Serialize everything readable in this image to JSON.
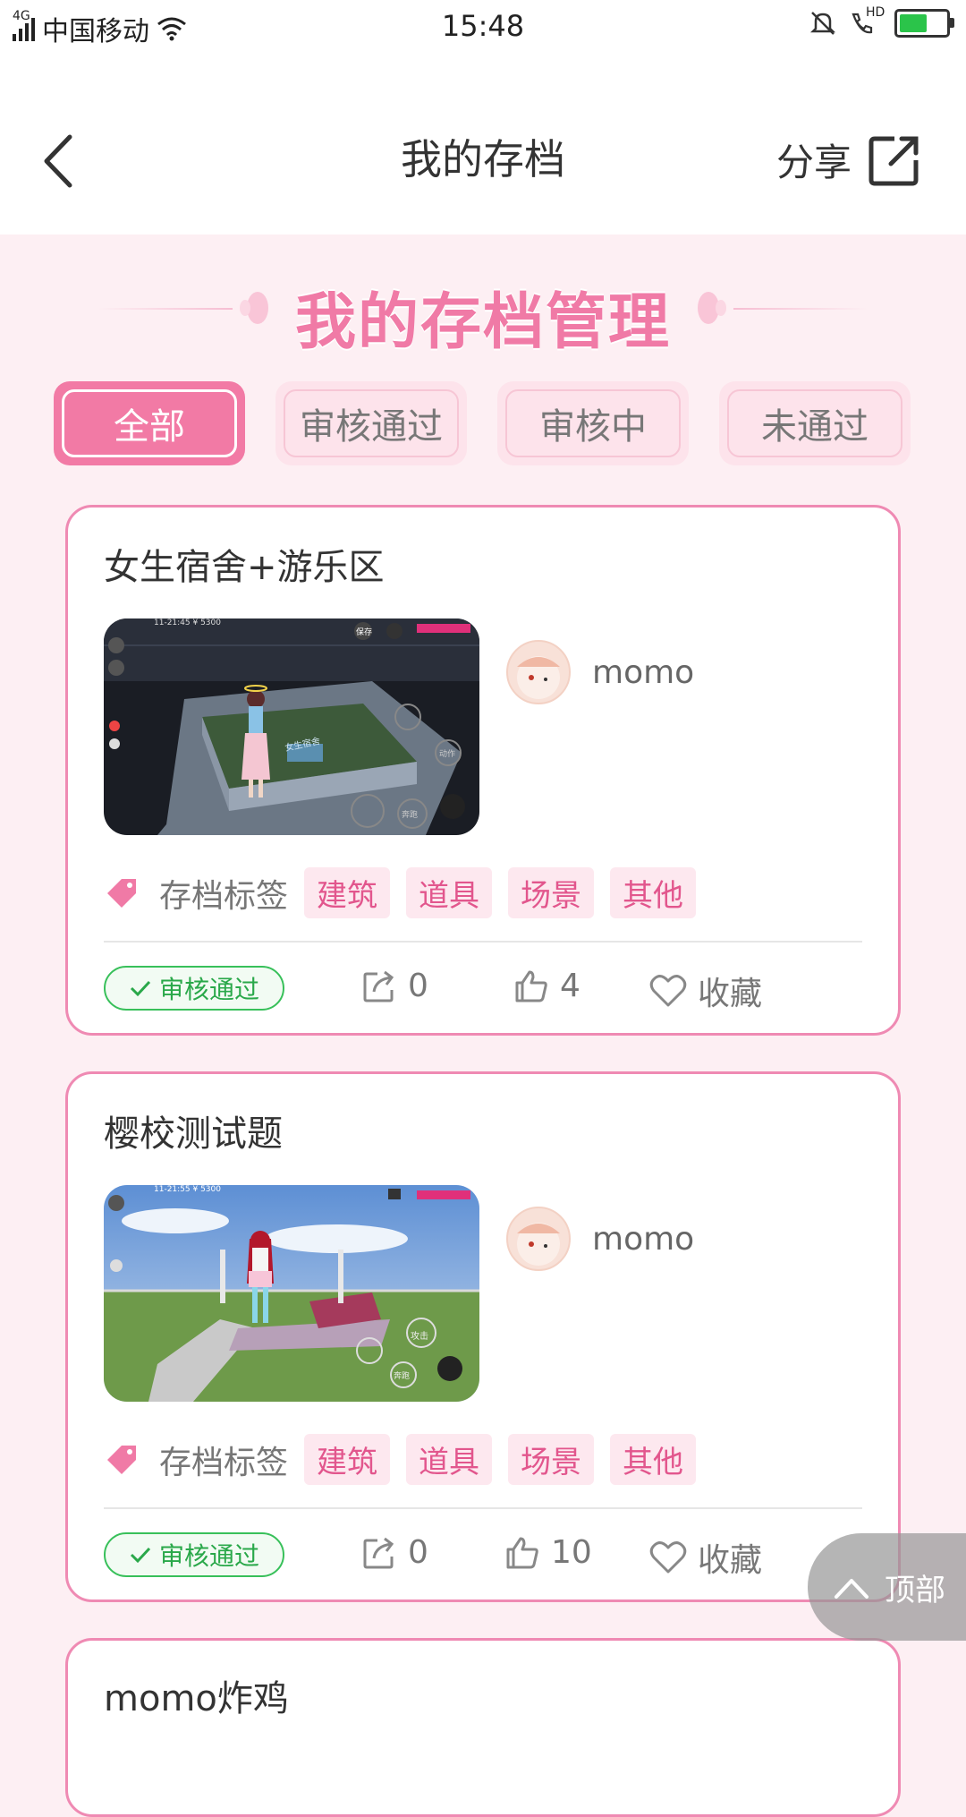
{
  "status_bar": {
    "network": "4G",
    "carrier": "中国移动",
    "time": "15:48",
    "hd_label": "HD"
  },
  "nav": {
    "title": "我的存档",
    "share_label": "分享"
  },
  "banner": {
    "title": "我的存档管理"
  },
  "tabs": [
    {
      "label": "全部",
      "active": true
    },
    {
      "label": "审核通过",
      "active": false
    },
    {
      "label": "审核中",
      "active": false
    },
    {
      "label": "未通过",
      "active": false
    }
  ],
  "cards": [
    {
      "title": "女生宿舍+游乐区",
      "author": "momo",
      "tag_label": "存档标签",
      "tags": [
        "建筑",
        "道具",
        "场景",
        "其他"
      ],
      "status": "审核通过",
      "shares": "0",
      "likes": "4",
      "favorite_label": "收藏",
      "thumb_overlay": {
        "hud_text": "11-21:45  ¥ 5300",
        "save_label": "保存",
        "sign_text": "女生宿舍",
        "btn_run": "奔跑",
        "btn_action": "动作"
      }
    },
    {
      "title": "樱校测试题",
      "author": "momo",
      "tag_label": "存档标签",
      "tags": [
        "建筑",
        "道具",
        "场景",
        "其他"
      ],
      "status": "审核通过",
      "shares": "0",
      "likes": "10",
      "favorite_label": "收藏",
      "thumb_overlay": {
        "hud_text": "11-21:55  ¥ 5300",
        "btn_attack": "攻击",
        "btn_run": "奔跑"
      }
    },
    {
      "title": "momo炸鸡"
    }
  ],
  "back_to_top": "顶部",
  "colors": {
    "accent": "#f27aa5",
    "page_bg": "#fdeff3",
    "approved_green": "#2aa84a",
    "tag_text": "#e2568d"
  }
}
